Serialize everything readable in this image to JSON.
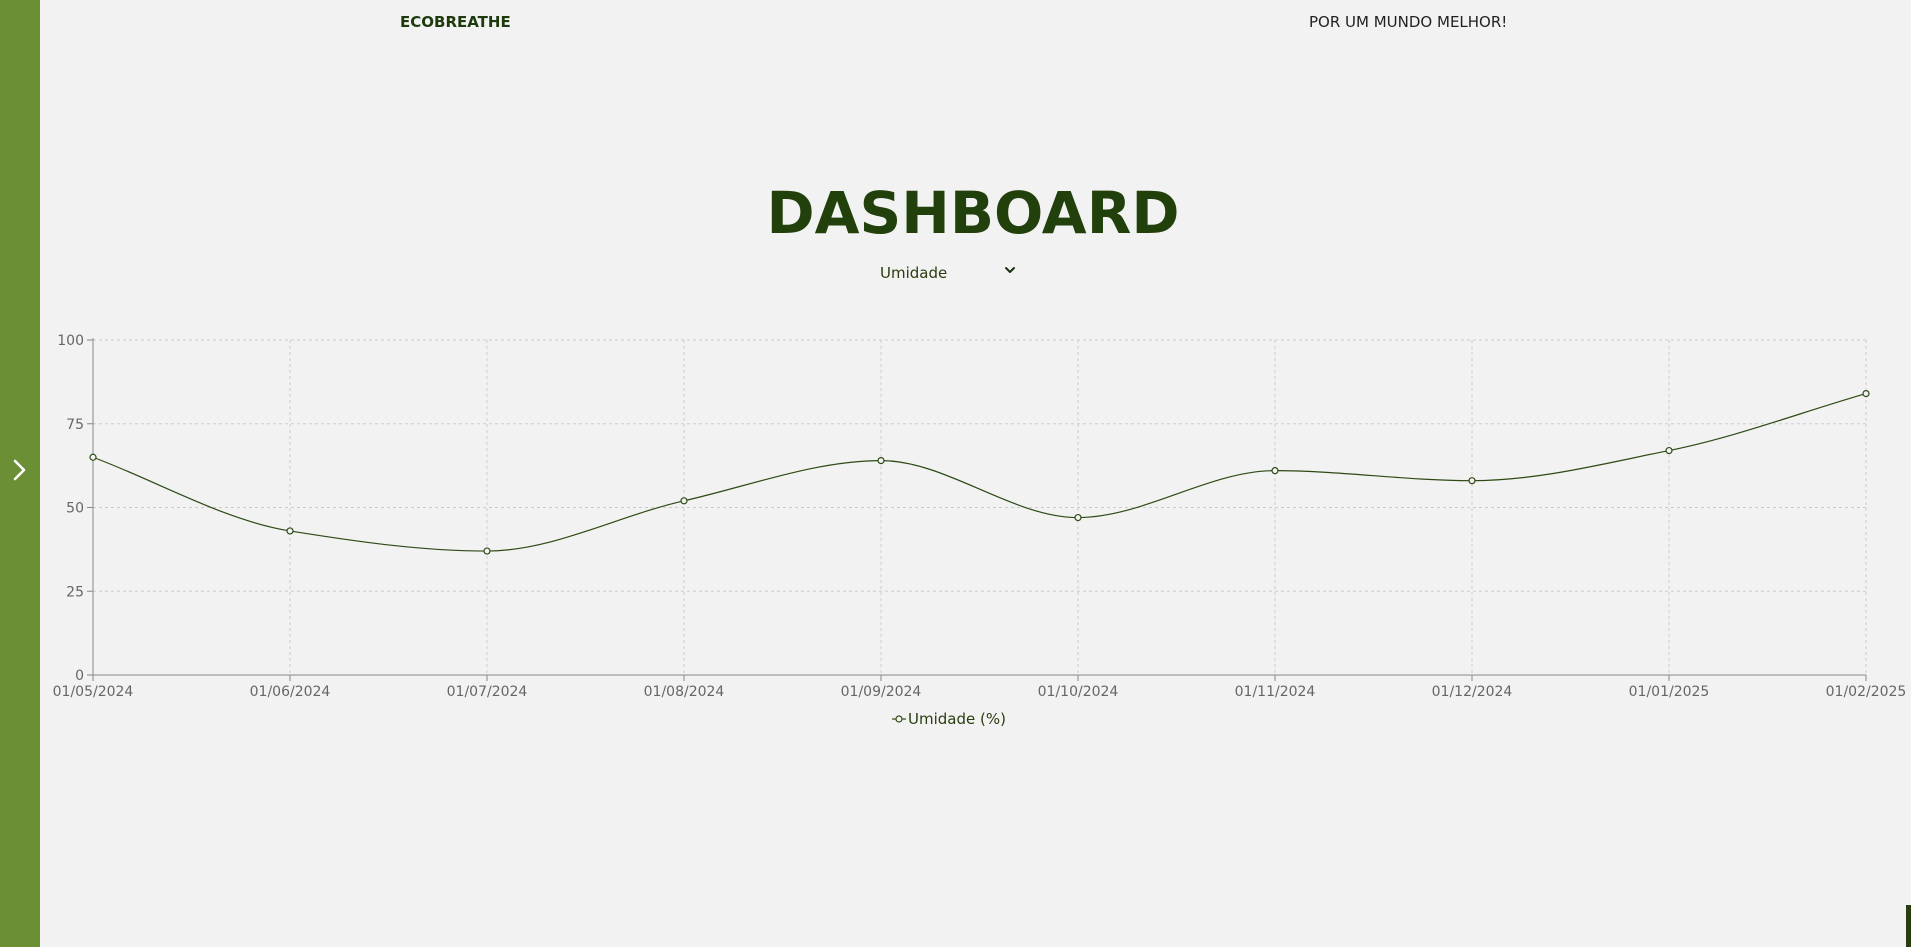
{
  "header": {
    "brand": "ECOBREATHE",
    "tagline": "POR UM MUNDO MELHOR!"
  },
  "page": {
    "title": "DASHBOARD"
  },
  "metric_select": {
    "selected": "Umidade"
  },
  "icons": {
    "sidebar_toggle": "chevron-right-icon",
    "select": "chevron-down-icon"
  },
  "colors": {
    "sidebar": "#6a8f35",
    "title": "#22400b",
    "line": "#2d4a14",
    "background": "#f2f2f2"
  },
  "chart_data": {
    "type": "line",
    "x": [
      "01/05/2024",
      "01/06/2024",
      "01/07/2024",
      "01/08/2024",
      "01/09/2024",
      "01/10/2024",
      "01/11/2024",
      "01/12/2024",
      "01/01/2025",
      "01/02/2025"
    ],
    "series": [
      {
        "name": "Umidade (%)",
        "values": [
          65,
          43,
          37,
          52,
          64,
          47,
          61,
          58,
          67,
          84
        ]
      }
    ],
    "yticks": [
      "0",
      "25",
      "50",
      "75",
      "100"
    ],
    "ylim": [
      0,
      100
    ],
    "grid": true,
    "legend": "bottom-center"
  }
}
